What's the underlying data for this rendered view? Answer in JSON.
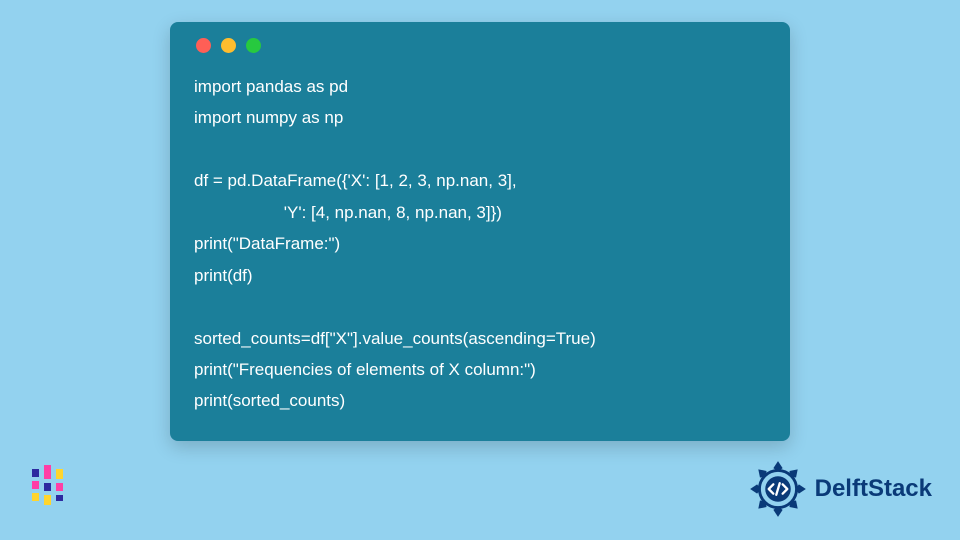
{
  "code": {
    "lines": [
      "import pandas as pd",
      "import numpy as np",
      "",
      "df = pd.DataFrame({'X': [1, 2, 3, np.nan, 3],",
      "                   'Y': [4, np.nan, 8, np.nan, 3]})",
      "print(\"DataFrame:\")",
      "print(df)",
      "",
      "sorted_counts=df[\"X\"].value_counts(ascending=True)",
      "print(\"Frequencies of elements of X column:\")",
      "print(sorted_counts)"
    ]
  },
  "window": {
    "dots": [
      "red",
      "yellow",
      "green"
    ]
  },
  "brand": {
    "name": "DelftStack"
  }
}
